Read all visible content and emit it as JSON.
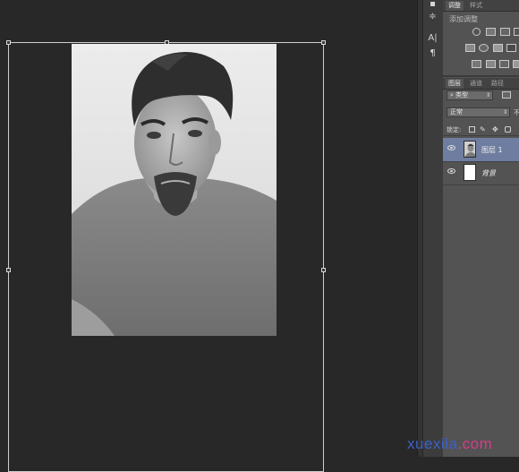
{
  "canvas": {
    "photo_alt": "portrait photo"
  },
  "panels": {
    "adjust_tabs": [
      "调整",
      "样式"
    ],
    "adjust_subtitle": "添加调整",
    "layer_tabs": [
      "图层",
      "通道",
      "路径"
    ],
    "filter_kind": "类型",
    "blend_mode": "正常",
    "opacity_label_fragment": "不",
    "lock_label": "锁定:",
    "layers": [
      {
        "name": "图层 1",
        "selected": true,
        "italic": false
      },
      {
        "name": "背景",
        "selected": false,
        "italic": true
      }
    ]
  },
  "tools": {
    "icons": [
      "tool-preset-icon",
      "adjust-sliders-icon",
      "character-icon",
      "paragraph-icon"
    ],
    "character_glyph": "A|",
    "paragraph_glyph": "¶"
  },
  "watermark": {
    "text_a": "xuexila",
    "text_b": ".com",
    "color_a": "#3a62c8",
    "color_b": "#d63c8a"
  }
}
